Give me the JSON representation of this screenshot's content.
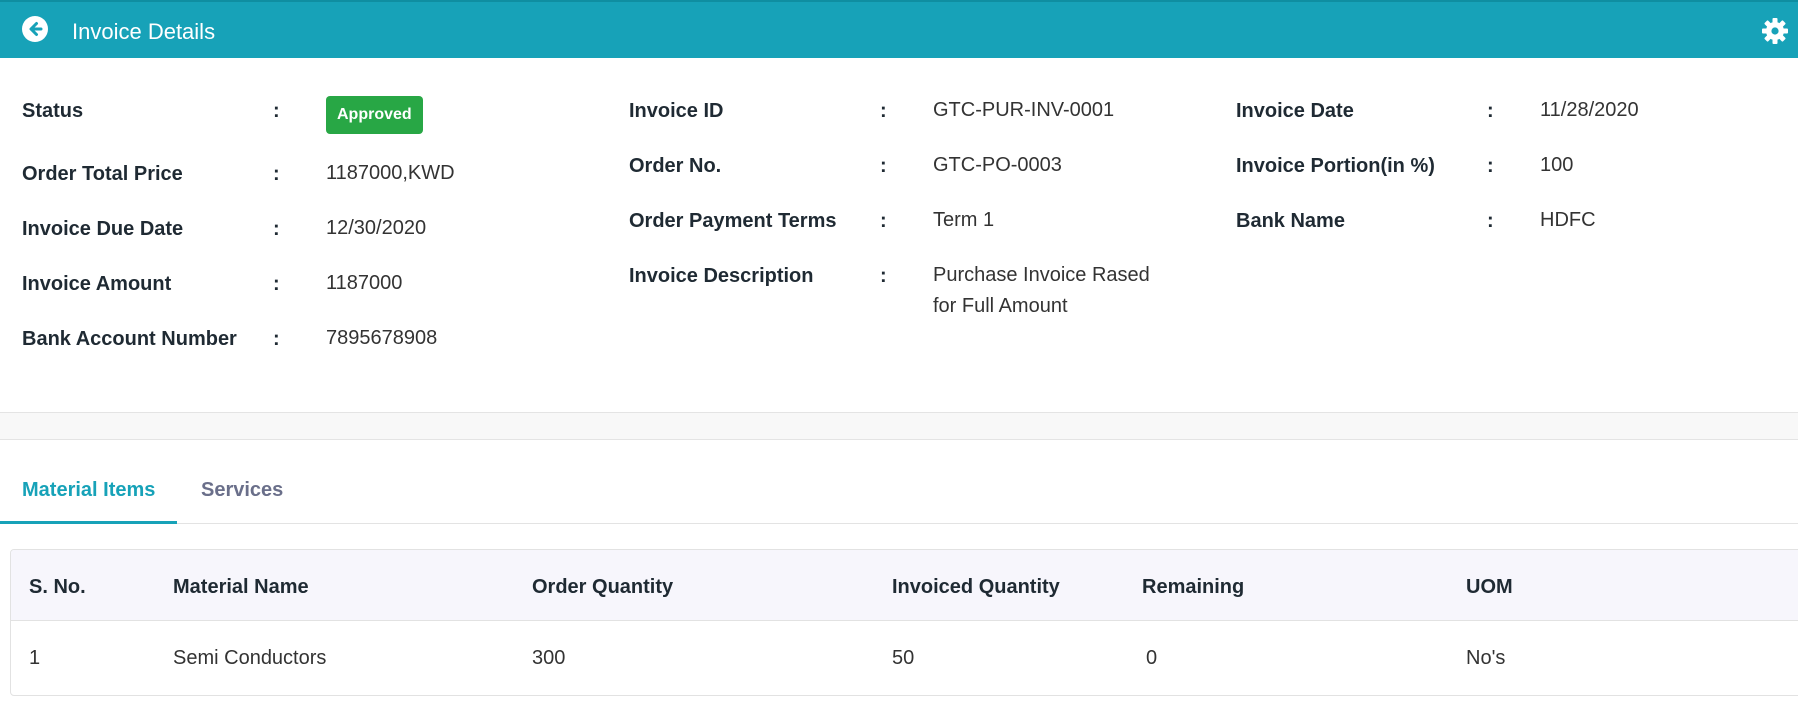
{
  "header": {
    "title": "Invoice Details",
    "bg_color": "#17a2b8",
    "back_icon": "arrow-left-circle-icon",
    "settings_icon": "gear-icon"
  },
  "details": {
    "col1": [
      {
        "label": "Status",
        "value": "Approved",
        "badge": true,
        "badge_color": "#28a745"
      },
      {
        "label": "Order Total Price",
        "value": "1187000,KWD"
      },
      {
        "label": "Invoice Due Date",
        "value": "12/30/2020"
      },
      {
        "label": "Invoice Amount",
        "value": "1187000"
      },
      {
        "label": "Bank Account Number",
        "value": "7895678908"
      }
    ],
    "col2": [
      {
        "label": "Invoice ID",
        "value": "GTC-PUR-INV-0001"
      },
      {
        "label": "Order No.",
        "value": "GTC-PO-0003"
      },
      {
        "label": "Order Payment Terms",
        "value": "Term 1"
      },
      {
        "label": "Invoice Description",
        "value_line1": "Purchase Invoice Rased",
        "value_line2": "for Full Amount"
      }
    ],
    "col3": [
      {
        "label": "Invoice Date",
        "value": "11/28/2020"
      },
      {
        "label": "Invoice Portion(in %)",
        "value": "100"
      },
      {
        "label": "Bank Name",
        "value": "HDFC"
      }
    ],
    "separator": ":"
  },
  "tabs": [
    {
      "label": "Material Items",
      "active": true
    },
    {
      "label": "Services",
      "active": false
    }
  ],
  "table": {
    "columns": [
      "S. No.",
      "Material Name",
      "Order Quantity",
      "Invoiced Quantity",
      "Remaining",
      "UOM"
    ],
    "rows": [
      [
        "1",
        "Semi Conductors",
        "300",
        "50",
        "0",
        "No's"
      ]
    ]
  }
}
